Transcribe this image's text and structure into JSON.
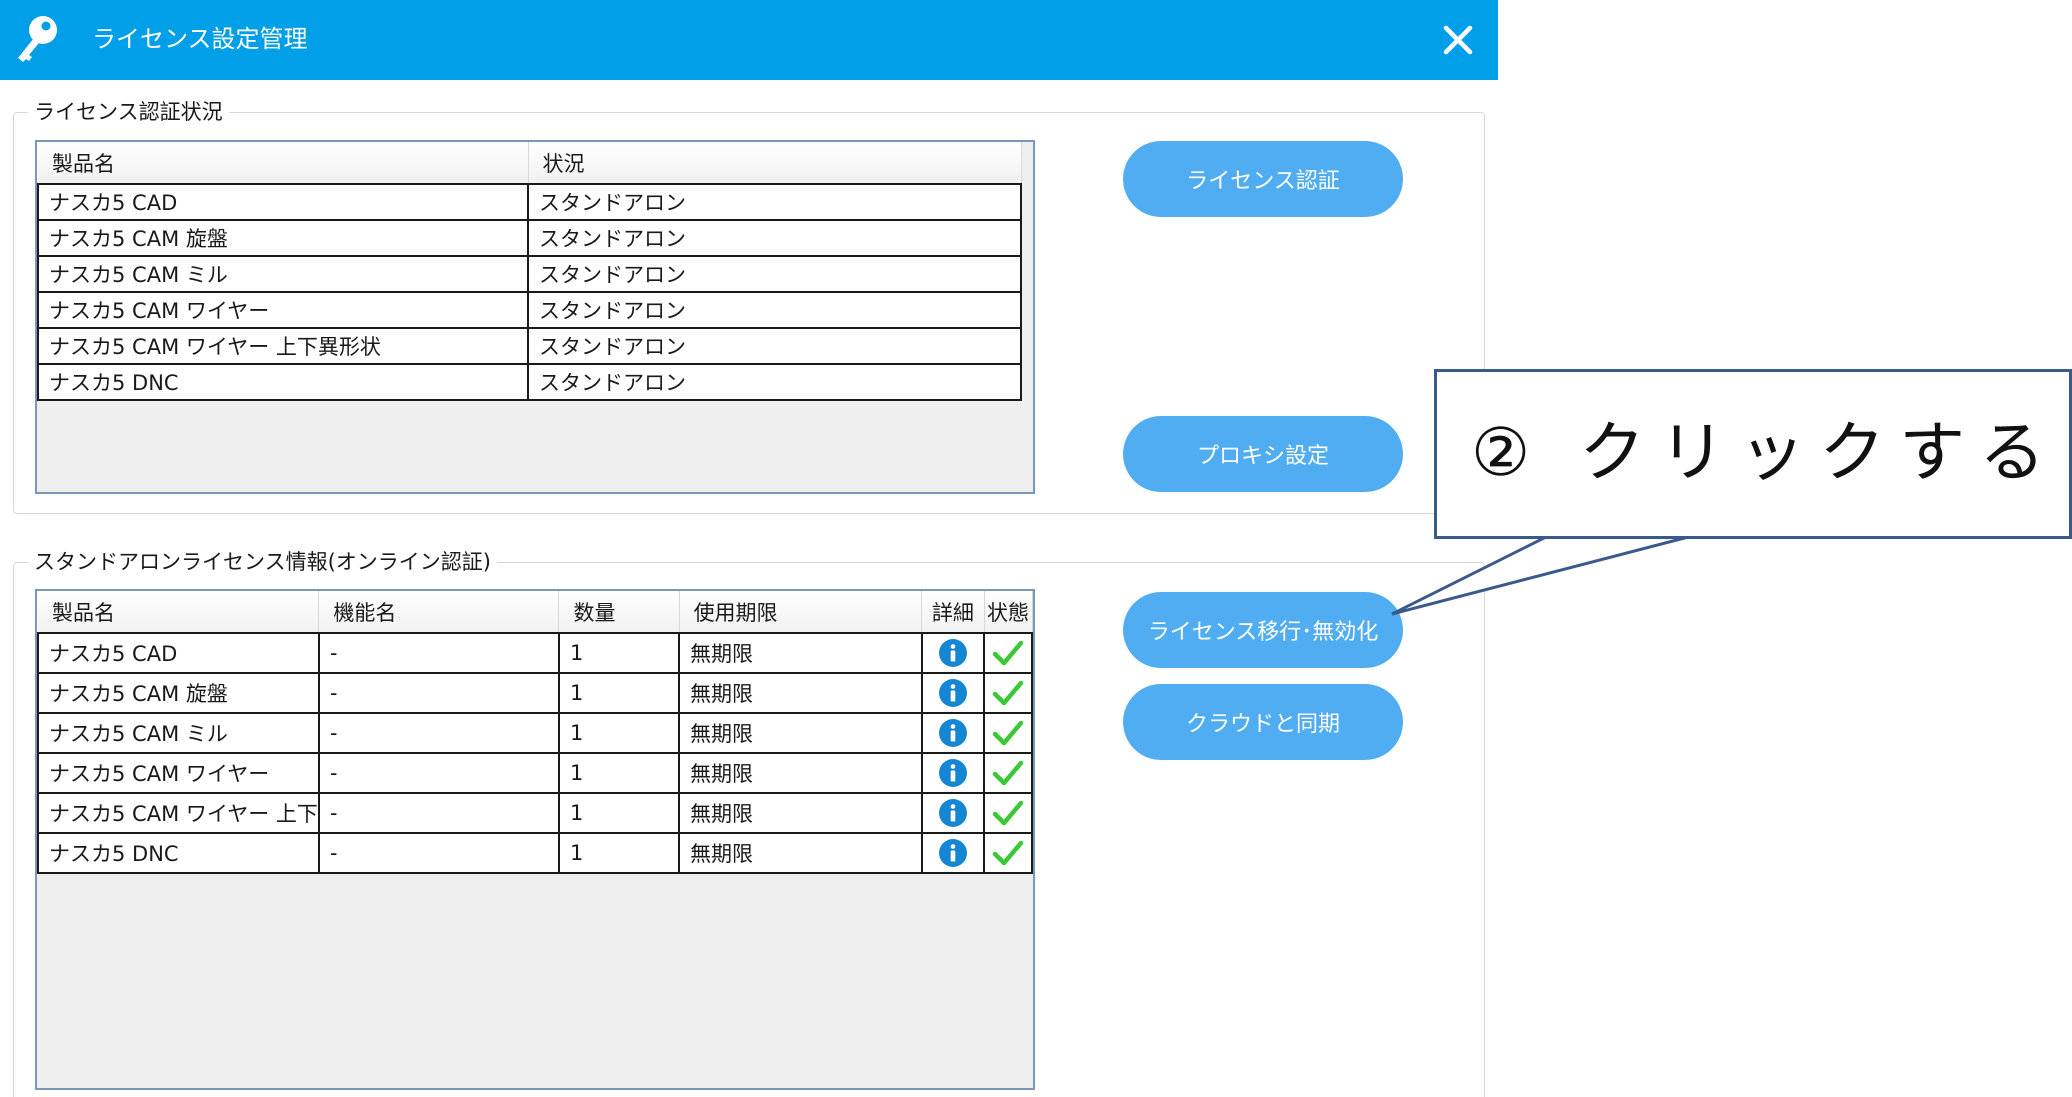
{
  "window": {
    "title": "ライセンス設定管理",
    "accent_color": "#009fe8",
    "close_icon": "close-icon",
    "app_icon": "key-icon"
  },
  "auth_status": {
    "group_title": "ライセンス認証状況",
    "columns": [
      "製品名",
      "状況"
    ],
    "rows": [
      {
        "product": "ナスカ5 CAD",
        "status": "スタンドアロン"
      },
      {
        "product": "ナスカ5 CAM 旋盤",
        "status": "スタンドアロン"
      },
      {
        "product": "ナスカ5 CAM ミル",
        "status": "スタンドアロン"
      },
      {
        "product": "ナスカ5 CAM ワイヤー",
        "status": "スタンドアロン"
      },
      {
        "product": "ナスカ5 CAM ワイヤー 上下異形状",
        "status": "スタンドアロン"
      },
      {
        "product": "ナスカ5 DNC",
        "status": "スタンドアロン"
      }
    ]
  },
  "standalone": {
    "group_title": "スタンドアロンライセンス情報(オンライン認証)",
    "columns": [
      "製品名",
      "機能名",
      "数量",
      "使用期限",
      "詳細",
      "状態"
    ],
    "rows": [
      {
        "product": "ナスカ5 CAD",
        "feature": "-",
        "quantity": "1",
        "expiry": "無期限",
        "detail_icon": "info-icon",
        "state_icon": "check-icon"
      },
      {
        "product": "ナスカ5 CAM 旋盤",
        "feature": "-",
        "quantity": "1",
        "expiry": "無期限",
        "detail_icon": "info-icon",
        "state_icon": "check-icon"
      },
      {
        "product": "ナスカ5 CAM ミル",
        "feature": "-",
        "quantity": "1",
        "expiry": "無期限",
        "detail_icon": "info-icon",
        "state_icon": "check-icon"
      },
      {
        "product": "ナスカ5 CAM ワイヤー",
        "feature": "-",
        "quantity": "1",
        "expiry": "無期限",
        "detail_icon": "info-icon",
        "state_icon": "check-icon"
      },
      {
        "product": "ナスカ5 CAM ワイヤー 上下",
        "feature": "-",
        "quantity": "1",
        "expiry": "無期限",
        "detail_icon": "info-icon",
        "state_icon": "check-icon"
      },
      {
        "product": "ナスカ5 DNC",
        "feature": "-",
        "quantity": "1",
        "expiry": "無期限",
        "detail_icon": "info-icon",
        "state_icon": "check-icon"
      }
    ]
  },
  "buttons": {
    "license_auth": "ライセンス認証",
    "proxy_settings": "プロキシ設定",
    "migrate_disable": "ライセンス移行･無効化",
    "cloud_sync": "クラウドと同期",
    "color": "#51adf2"
  },
  "annotation": {
    "text": "② クリックする",
    "border_color": "#3b5a8c"
  }
}
